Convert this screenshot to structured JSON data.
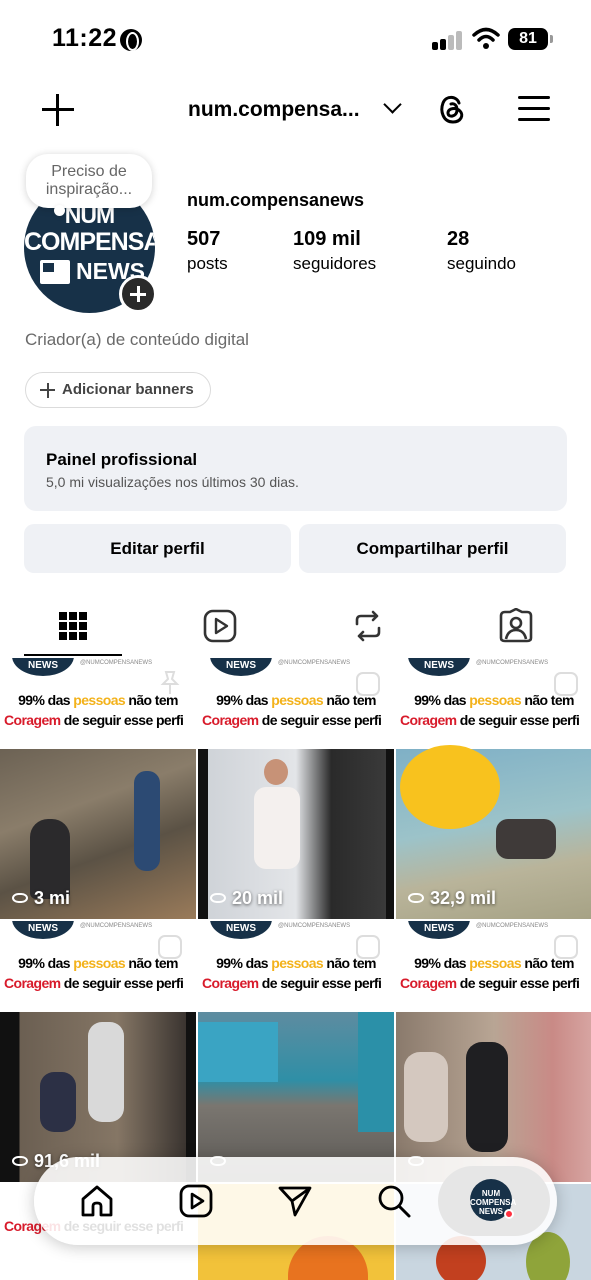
{
  "status": {
    "time": "11:22",
    "battery": "81"
  },
  "header": {
    "username": "num.compensa..."
  },
  "profile": {
    "note": "Preciso de inspiração...",
    "name": "num.compensanews",
    "avatar_text": [
      "NUM",
      "COMPENSA",
      "NEWS"
    ],
    "stats": [
      {
        "value": "507",
        "label": "posts"
      },
      {
        "value": "109 mil",
        "label": "seguidores"
      },
      {
        "value": "28",
        "label": "seguindo"
      }
    ],
    "category": "Criador(a) de conteúdo digital",
    "banners_label": "Adicionar banners"
  },
  "panel": {
    "title": "Painel profissional",
    "subtitle": "5,0 mi visualizações nos últimos 30 dias."
  },
  "actions": {
    "edit": "Editar perfil",
    "share": "Compartilhar perfil"
  },
  "tabs": [
    "grid-icon",
    "reels-icon",
    "reposts-icon",
    "tagged-icon"
  ],
  "post_header": {
    "handle": "@NUMCOMPENSANEWS",
    "logo": "NEWS",
    "line1_a": "99% das ",
    "line1_b": "pessoas",
    "line1_c": " não tem",
    "line2_a": "Coragem",
    "line2_b": " de seguir esse perfi"
  },
  "posts": [
    {
      "views": "3 mi"
    },
    {
      "views": "20 mil"
    },
    {
      "views": "32,9 mil"
    },
    {
      "views": "91,6 mil"
    },
    {
      "views": ""
    },
    {
      "views": ""
    }
  ],
  "nav": [
    "home-icon",
    "reels-icon",
    "send-icon",
    "search-icon",
    "profile-avatar"
  ],
  "colors": {
    "brand_navy": "#173148",
    "accent_yellow": "#f3b21b",
    "accent_red": "#d81b2b",
    "panel_bg": "#eff1f5"
  }
}
